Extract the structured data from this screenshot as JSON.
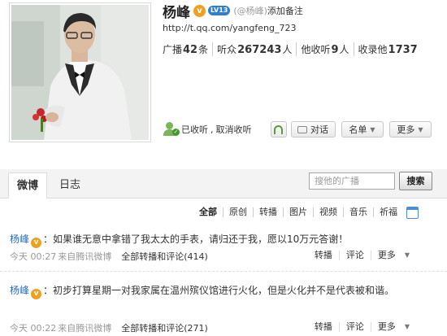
{
  "profile": {
    "name": "杨峰",
    "vip_badge": "v",
    "level_badge": "LV13",
    "handle": "(@杨峰)",
    "add_note": "添加备注",
    "url": "http://t.qq.com/yangfeng_723",
    "stats": [
      {
        "label": "广播",
        "value": "42",
        "unit": "条"
      },
      {
        "label": "听众",
        "value": "267243",
        "unit": "人"
      },
      {
        "label": "他收听",
        "value": "9",
        "unit": "人"
      },
      {
        "label": "收录他",
        "value": "1737",
        "unit": ""
      }
    ],
    "follow_status": "已收听",
    "separator": ",",
    "unfollow": "取消收听",
    "chat_label": "对话",
    "card_label": "名单",
    "more_label": "更多",
    "caret": "▼",
    "check": "✓"
  },
  "tabs": {
    "weibo": "微博",
    "diary": "日志"
  },
  "search": {
    "placeholder": "搜他的广播",
    "button": "搜索"
  },
  "filters": [
    "全部",
    "原创",
    "转播",
    "图片",
    "视频",
    "音乐",
    "祈福"
  ],
  "posts": [
    {
      "author": "杨峰",
      "text": "：如果谁无意中拿错了我太太的手表，请归还于我，愿以10万元答谢！",
      "time": "今天 00:27",
      "source": "来自腾讯微博",
      "count_label": "全部转播和评论(414)",
      "actions": [
        "转播",
        "评论",
        "更多"
      ]
    },
    {
      "author": "杨峰",
      "text": "：初步打算星期一对我家属在温州殡仪馆进行火化，但是火化并不是代表被和谐。",
      "time": "今天 00:22",
      "source": "来自腾讯微博",
      "count_label": "全部转播和评论(271)",
      "actions": [
        "转播",
        "评论",
        "更多"
      ]
    }
  ],
  "colors": {
    "accent_link": "#2d6cb5",
    "vip_orange": "#f0a020",
    "level_blue": "#2f7fd0",
    "follow_green": "#7cb45a"
  }
}
